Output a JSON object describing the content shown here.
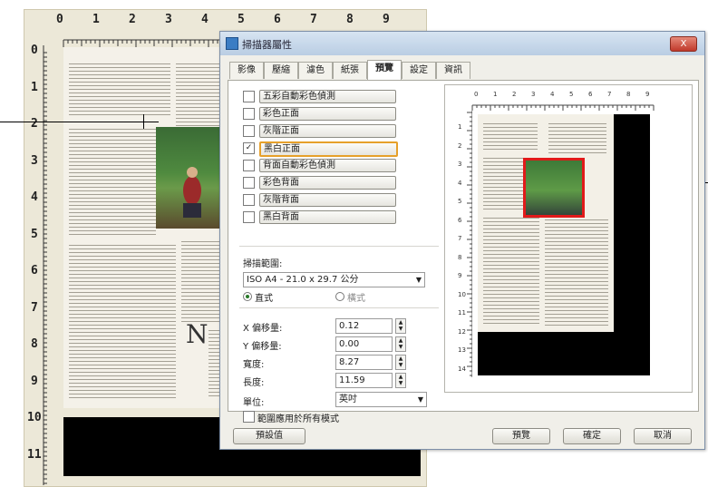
{
  "ruler": {
    "top_numbers": [
      "0",
      "1",
      "2",
      "3",
      "4",
      "5",
      "6",
      "7",
      "8",
      "9"
    ],
    "left_numbers": [
      "0",
      "1",
      "2",
      "3",
      "4",
      "5",
      "6",
      "7",
      "8",
      "9",
      "10",
      "11"
    ]
  },
  "document_page": {
    "drop_cap": "N"
  },
  "dialog": {
    "title": "掃描器屬性",
    "close_label": "X",
    "tabs": [
      "影像",
      "壓縮",
      "濾色",
      "紙張",
      "預覽",
      "設定",
      "資訊"
    ],
    "active_tab": "預覽",
    "image_options": [
      {
        "label": "五彩自動彩色偵測",
        "checked": false
      },
      {
        "label": "彩色正面",
        "checked": false
      },
      {
        "label": "灰階正面",
        "checked": false
      },
      {
        "label": "黑白正面",
        "checked": true
      },
      {
        "label": "背面自動彩色偵測",
        "checked": false
      },
      {
        "label": "彩色背面",
        "checked": false
      },
      {
        "label": "灰階背面",
        "checked": false
      },
      {
        "label": "黑白背面",
        "checked": false
      }
    ],
    "scan_area_label": "掃描範圍:",
    "scan_area_value": "ISO A4 - 21.0 x 29.7 公分",
    "orientation": [
      {
        "label": "直式",
        "selected": true
      },
      {
        "label": "橫式",
        "selected": false
      }
    ],
    "fields": [
      {
        "label": "X 偏移量:",
        "value": "0.12"
      },
      {
        "label": "Y 偏移量:",
        "value": "0.00"
      },
      {
        "label": "寬度:",
        "value": "8.27"
      },
      {
        "label": "長度:",
        "value": "11.59"
      }
    ],
    "unit_label": "單位:",
    "unit_value": "英吋",
    "apply_all_label": "範圍應用於所有模式",
    "apply_all_checked": false,
    "buttons": {
      "default": "預設值",
      "preview": "預覽",
      "ok": "確定",
      "cancel": "取消"
    },
    "preview_top_numbers": [
      "0",
      "1",
      "2",
      "3",
      "4",
      "5",
      "6",
      "7",
      "8",
      "9"
    ],
    "preview_left_numbers": [
      "1",
      "2",
      "3",
      "4",
      "5",
      "6",
      "7",
      "8",
      "9",
      "10",
      "11",
      "12",
      "13",
      "14"
    ]
  }
}
